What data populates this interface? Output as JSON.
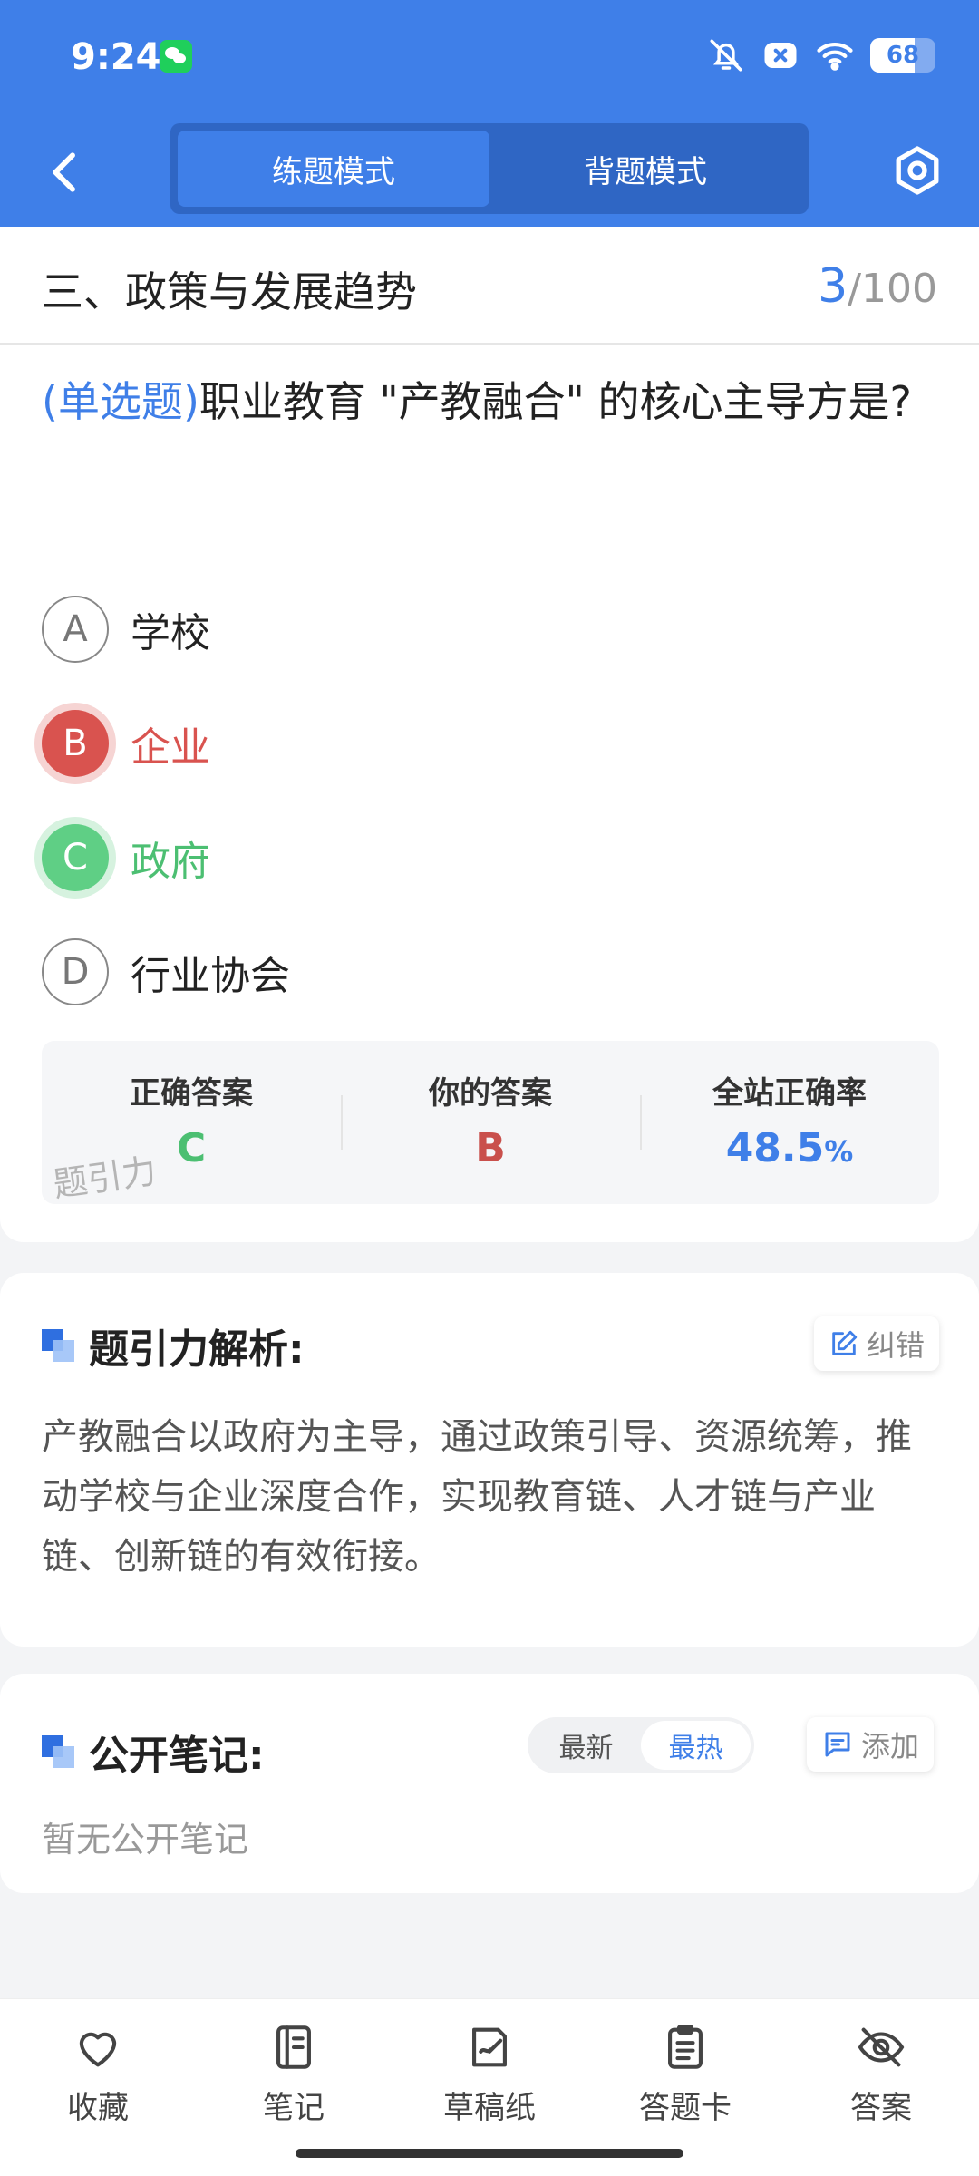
{
  "status_bar": {
    "time": "9:24",
    "battery": 68,
    "battery_text": "68"
  },
  "nav": {
    "modes": [
      "练题模式",
      "背题模式"
    ],
    "active_mode": 0
  },
  "section": {
    "title": "三、政策与发展趋势",
    "current": "3",
    "total": "/100"
  },
  "question": {
    "type": "(单选题)",
    "text": "职业教育 \"产教融合\" 的核心主导方是?",
    "options": [
      {
        "letter": "A",
        "text": "学校"
      },
      {
        "letter": "B",
        "text": "企业"
      },
      {
        "letter": "C",
        "text": "政府"
      },
      {
        "letter": "D",
        "text": "行业协会"
      }
    ]
  },
  "stats": {
    "correct_label": "正确答案",
    "correct_value": "C",
    "yours_label": "你的答案",
    "yours_value": "B",
    "rate_label": "全站正确率",
    "rate_value": "48.5",
    "rate_unit": "%",
    "watermark": "题引力"
  },
  "analysis": {
    "title": "题引力解析:",
    "report_label": "纠错",
    "text": "产教融合以政府为主导，通过政策引导、资源统筹，推动学校与企业深度合作，实现教育链、人才链与产业链、创新链的有效衔接。"
  },
  "notes": {
    "title": "公开笔记:",
    "sort_options": [
      "最新",
      "最热"
    ],
    "active_sort": 1,
    "add_label": "添加",
    "empty_text": "暂无公开笔记"
  },
  "bottom_tabs": [
    "收藏",
    "笔记",
    "草稿纸",
    "答题卡",
    "答案"
  ],
  "colors": {
    "primary": "#3f7fe8",
    "wrong": "#d9534f",
    "right": "#5fcf85"
  }
}
